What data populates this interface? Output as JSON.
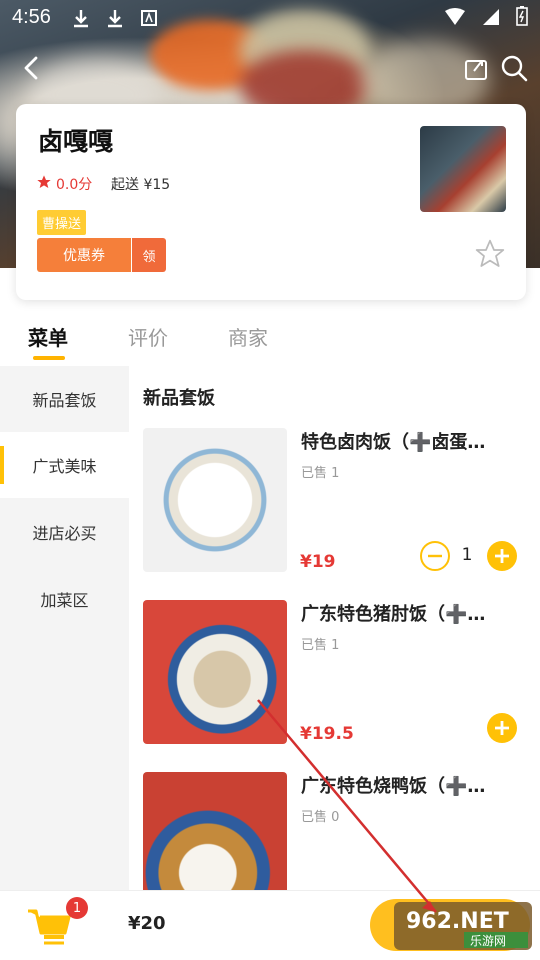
{
  "status_bar": {
    "time": "4:56"
  },
  "store": {
    "name": "卤嘎嘎",
    "rating": "0.0分",
    "min_order": "起送 ¥15",
    "delivery_tag": "曹操送",
    "coupon_label": "优惠券",
    "claim_label": "领"
  },
  "tabs": [
    {
      "label": "菜单"
    },
    {
      "label": "评价"
    },
    {
      "label": "商家"
    }
  ],
  "sidebar": {
    "items": [
      {
        "label": "新品套饭"
      },
      {
        "label": "广式美味"
      },
      {
        "label": "进店必买"
      },
      {
        "label": "加菜区"
      }
    ],
    "active_index": 1
  },
  "menu": {
    "section_title": "新品套饭",
    "dishes": [
      {
        "name": "特色卤肉饭（➕卤蛋…",
        "sold": "已售 1",
        "price": "¥19",
        "quantity": "1"
      },
      {
        "name": "广东特色猪肘饭（➕…",
        "sold": "已售 1",
        "price": "¥19.5"
      },
      {
        "name": "广东特色烧鸭饭（➕…",
        "sold": "已售 0"
      }
    ]
  },
  "cart": {
    "badge": "1",
    "total": "¥20"
  },
  "watermark": {
    "text": "962.NET",
    "sub": "乐游网"
  },
  "colors": {
    "accent": "#ffc107",
    "price": "#e53935",
    "coupon": "#f57f3a"
  }
}
